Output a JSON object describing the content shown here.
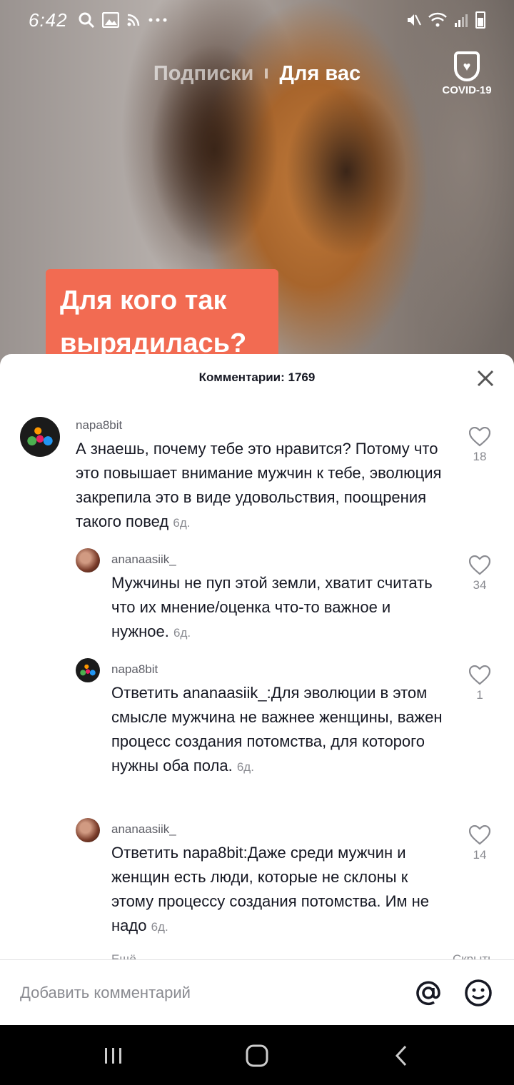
{
  "status_bar": {
    "time": "6:42",
    "left_icons": [
      "search-icon",
      "image-icon",
      "rss-icon",
      "more-dots-icon"
    ],
    "right_icons": [
      "mute-icon",
      "wifi-icon",
      "signal-icon",
      "battery-icon"
    ]
  },
  "top_nav": {
    "tabs": [
      {
        "label": "Подписки",
        "active": false
      },
      {
        "label": "Для вас",
        "active": true
      }
    ],
    "covid_label": "COVID-19"
  },
  "video": {
    "caption": "Для кого так вырядилась?"
  },
  "comments_sheet": {
    "title": "Комментарии: 1769",
    "comments": [
      {
        "username": "napa8bit",
        "text": "А знаешь, почему тебе это нравится? Потому что это повышает внимание мужчин к тебе, эволюция закрепила это в виде удовольствия, поощрения такого повед",
        "date": "6д.",
        "likes": "18",
        "is_reply": false
      },
      {
        "username": "ananaasiik_",
        "text": "Мужчины не пуп этой земли, хватит считать что их мнение/оценка что-то важное и нужное.",
        "date": "6д.",
        "likes": "34",
        "is_reply": true
      },
      {
        "username": "napa8bit",
        "reply_prefix": "Ответить",
        "reply_to": "ananaasiik_",
        "text": ":Для эволюции в этом смысле мужчина не важнее женщины, важен процесс создания потомства, для которого нужны оба пола.",
        "date": "6д.",
        "likes": "1",
        "is_reply": true
      },
      {
        "username": "ananaasiik_",
        "reply_prefix": "Ответить",
        "reply_to": "napa8bit",
        "text": ":Даже среди мужчин и женщин есть люди, которые не склоны к этому процессу создания потомства. Им не надо",
        "date": "6д.",
        "likes": "14",
        "is_reply": true
      }
    ],
    "more_replies": "Ещё",
    "hide": "Скрыть"
  },
  "input_bar": {
    "placeholder": "Добавить комментарий"
  },
  "colors": {
    "caption_bg": "#f26b52",
    "text_primary": "#161823",
    "text_secondary": "#8a8b91"
  }
}
